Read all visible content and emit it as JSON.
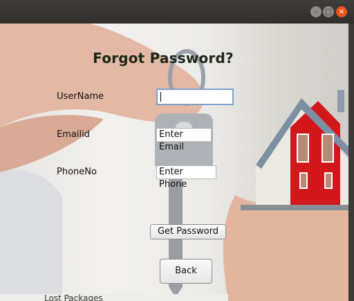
{
  "form": {
    "title": "Forgot Password?",
    "username_label": "UserName",
    "username_value": "",
    "email_label": "Emailid",
    "email_placeholder": "Enter Email",
    "phone_label": "PhoneNo",
    "phone_placeholder": "Enter Phone",
    "get_password_label": "Get Password",
    "back_label": "Back"
  },
  "background_peek": {
    "text": "Lost Packages"
  },
  "colors": {
    "close_button": "#e95420",
    "house_red": "#d3181b",
    "house_roof": "#7c8fa3"
  }
}
